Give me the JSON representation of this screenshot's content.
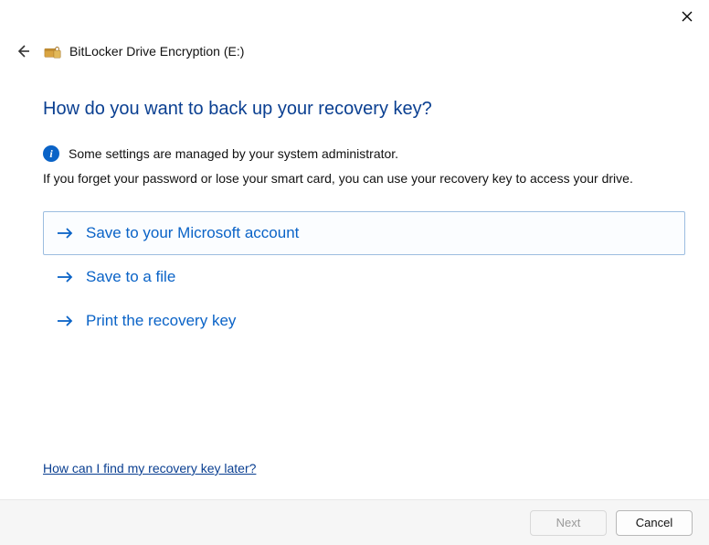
{
  "window": {
    "title": "BitLocker Drive Encryption (E:)"
  },
  "main": {
    "heading": "How do you want to back up your recovery key?",
    "info": "Some settings are managed by your system administrator.",
    "subtext": "If you forget your password or lose your smart card, you can use your recovery key to access your drive.",
    "options": [
      {
        "label": "Save to your Microsoft account",
        "selected": true
      },
      {
        "label": "Save to a file",
        "selected": false
      },
      {
        "label": "Print the recovery key",
        "selected": false
      }
    ],
    "help_link": "How can I find my recovery key later?"
  },
  "footer": {
    "next": "Next",
    "cancel": "Cancel",
    "next_enabled": false
  }
}
